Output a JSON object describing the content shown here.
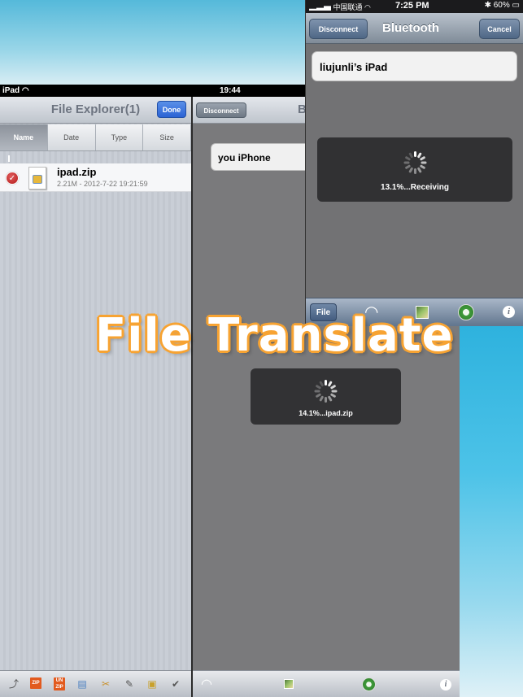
{
  "headline": "File Translate",
  "ipad": {
    "status": {
      "carrier": "iPad",
      "time": "19:44"
    },
    "file_explorer": {
      "title": "File Explorer(1)",
      "done_label": "Done",
      "sort_tabs": [
        "Name",
        "Date",
        "Type",
        "Size"
      ],
      "active_sort": "Name",
      "files": [
        {
          "name": "ipad.zip",
          "meta": "2.21M - 2012-7-22 19:21:59",
          "selected": true
        }
      ],
      "toolbar_icons": [
        "share-icon",
        "zip-icon",
        "unzip-icon",
        "copy-icon",
        "cut-icon",
        "edit-icon",
        "move-icon",
        "select-all-icon"
      ],
      "zip_label": "ZIP",
      "unzip_label": "UN ZIP"
    },
    "bluetooth": {
      "disconnect_label": "Disconnect",
      "title_partial": "B",
      "device": "you iPhone",
      "progress_text": "14.1%...ipad.zip",
      "toolbar_icons": [
        "wifi-icon",
        "photo-icon",
        "clock-icon",
        "info-icon"
      ]
    }
  },
  "iphone": {
    "status": {
      "carrier": "中国联通",
      "time": "7:25 PM",
      "battery": "60%"
    },
    "disconnect_label": "Disconnect",
    "title": "Bluetooth",
    "cancel_label": "Cancel",
    "device": "liujunli’s iPad",
    "progress_text": "13.1%...Receiving",
    "file_label": "File",
    "toolbar_icons": [
      "wifi-icon",
      "photo-icon",
      "clock-icon",
      "info-icon"
    ]
  },
  "colors": {
    "accent_orange": "#f7a332",
    "done_blue": "#2b63d4",
    "check_red": "#b41d1d"
  }
}
